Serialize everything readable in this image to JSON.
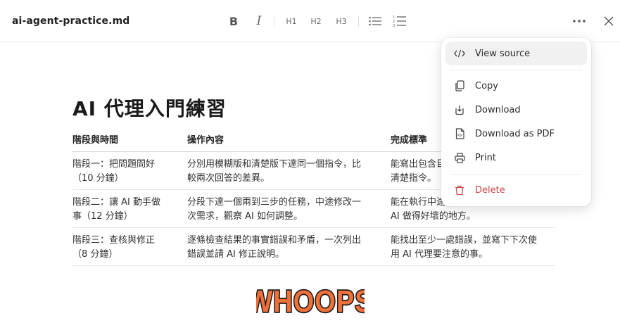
{
  "header": {
    "filename": "ai-agent-practice.md",
    "toolbar": {
      "bold_label": "B",
      "italic_label": "I",
      "h1_label": "H1",
      "h2_label": "H2",
      "h3_label": "H3"
    },
    "icons": [
      "bold-icon",
      "italic-icon",
      "bullet-list-icon",
      "numbered-list-icon",
      "more-icon",
      "close-icon"
    ]
  },
  "document": {
    "title": "AI 代理入門練習",
    "table": {
      "headers": [
        "階段與時間",
        "操作內容",
        "完成標準"
      ],
      "rows": [
        {
          "stage": [
            "階段一：把問題問好",
            "（10 分鐘）"
          ],
          "action": [
            "分別用模糊版和清楚版下達同一個指令，比",
            "較兩次回答的差異。"
          ],
          "criteria": [
            "能寫出包含目",
            "清楚指令。"
          ]
        },
        {
          "stage": [
            "階段二：讓 AI 動手做",
            "事（12 分鐘）"
          ],
          "action": [
            "分段下達一個兩到三步的任務，中途修改一",
            "次需求，觀察 AI 如何調整。"
          ],
          "criteria": [
            "能在執行中途",
            "AI 做得好壞的地方。"
          ]
        },
        {
          "stage": [
            "階段三：查核與修正",
            "（8 分鐘）"
          ],
          "action": [
            "逐條檢查結果的事實錯誤和矛盾，一次列出",
            "錯誤並請 AI 修正說明。"
          ],
          "criteria": [
            "能找出至少一處錯誤，並寫下下次使",
            "用 AI 代理要注意的事。"
          ]
        }
      ]
    }
  },
  "menu": {
    "items": [
      {
        "label": "View source",
        "icon": "code-icon"
      },
      {
        "label": "Copy",
        "icon": "copy-icon"
      },
      {
        "label": "Download",
        "icon": "download-icon"
      },
      {
        "label": "Download as PDF",
        "icon": "pdf-file-icon"
      },
      {
        "label": "Print",
        "icon": "printer-icon"
      },
      {
        "label": "Delete",
        "icon": "trash-icon"
      }
    ]
  },
  "banner": {
    "text": "WHOOPS"
  },
  "colors": {
    "danger": "#c94a4a",
    "whoops_fill": "#f0703a",
    "whoops_outline": "#1a1a1a"
  }
}
